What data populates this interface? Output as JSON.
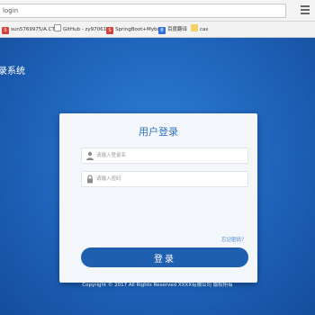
{
  "browser": {
    "url_fragment": "login",
    "bookmarks": [
      {
        "label": "sun5769975/A.CT.c",
        "icon_color": "#d0443a",
        "icon_text": "S"
      },
      {
        "label": "GitHub - zy970615",
        "icon_color": "#ffffff",
        "icon_text": ""
      },
      {
        "label": "SpringBoot+Mybo",
        "icon_color": "#d0443a",
        "icon_text": "S"
      },
      {
        "label": "百度翻译",
        "icon_color": "#2f6fd8",
        "icon_text": "B"
      },
      {
        "label": "cas",
        "icon_color": "#ffffff",
        "icon_text": ""
      }
    ]
  },
  "page": {
    "system_title": "录系统",
    "login_card": {
      "title": "用户登录",
      "username_placeholder": "请输入登录名",
      "password_placeholder": "请输入密码",
      "forgot_label": "忘记密码？",
      "login_button": "登录"
    },
    "footer": "Copyright © 2017 All Rights Reserved XXXX有限公司 版权所有"
  },
  "colors": {
    "background": "#1f63b8",
    "accent": "#1f5fb0",
    "card_title": "#2f72c4"
  },
  "icons": [
    "user-icon",
    "lock-icon",
    "menu-icon",
    "folder-icon",
    "document-icon"
  ]
}
